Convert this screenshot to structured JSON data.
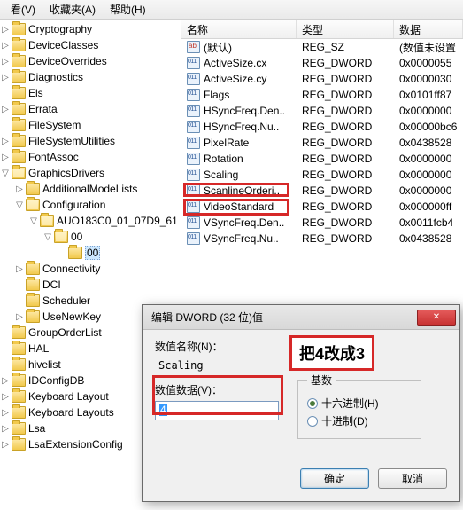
{
  "menu": {
    "view": "看(V)",
    "favorites": "收藏夹(A)",
    "help": "帮助(H)"
  },
  "tree": [
    {
      "label": "Cryptography",
      "depth": 0,
      "toggle": "▷"
    },
    {
      "label": "DeviceClasses",
      "depth": 0,
      "toggle": "▷"
    },
    {
      "label": "DeviceOverrides",
      "depth": 0,
      "toggle": "▷"
    },
    {
      "label": "Diagnostics",
      "depth": 0,
      "toggle": "▷"
    },
    {
      "label": "Els",
      "depth": 0,
      "toggle": ""
    },
    {
      "label": "Errata",
      "depth": 0,
      "toggle": "▷"
    },
    {
      "label": "FileSystem",
      "depth": 0,
      "toggle": ""
    },
    {
      "label": "FileSystemUtilities",
      "depth": 0,
      "toggle": "▷"
    },
    {
      "label": "FontAssoc",
      "depth": 0,
      "toggle": "▷"
    },
    {
      "label": "GraphicsDrivers",
      "depth": 0,
      "toggle": "▽",
      "open": true
    },
    {
      "label": "AdditionalModeLists",
      "depth": 1,
      "toggle": "▷"
    },
    {
      "label": "Configuration",
      "depth": 1,
      "toggle": "▽",
      "open": true
    },
    {
      "label": "AUO183C0_01_07D9_61",
      "depth": 2,
      "toggle": "▽",
      "open": true
    },
    {
      "label": "00",
      "depth": 3,
      "toggle": "▽",
      "open": true
    },
    {
      "label": "00",
      "depth": 4,
      "toggle": "",
      "selected": true
    },
    {
      "label": "Connectivity",
      "depth": 1,
      "toggle": "▷"
    },
    {
      "label": "DCI",
      "depth": 1,
      "toggle": ""
    },
    {
      "label": "Scheduler",
      "depth": 1,
      "toggle": ""
    },
    {
      "label": "UseNewKey",
      "depth": 1,
      "toggle": "▷"
    },
    {
      "label": "GroupOrderList",
      "depth": 0,
      "toggle": ""
    },
    {
      "label": "HAL",
      "depth": 0,
      "toggle": ""
    },
    {
      "label": "hivelist",
      "depth": 0,
      "toggle": ""
    },
    {
      "label": "IDConfigDB",
      "depth": 0,
      "toggle": "▷"
    },
    {
      "label": "Keyboard Layout",
      "depth": 0,
      "toggle": "▷"
    },
    {
      "label": "Keyboard Layouts",
      "depth": 0,
      "toggle": "▷"
    },
    {
      "label": "Lsa",
      "depth": 0,
      "toggle": "▷"
    },
    {
      "label": "LsaExtensionConfig",
      "depth": 0,
      "toggle": "▷"
    }
  ],
  "columns": {
    "name": "名称",
    "type": "类型",
    "data": "数据"
  },
  "rows": [
    {
      "icon": "sz",
      "name": "(默认)",
      "type": "REG_SZ",
      "data": "(数值未设置"
    },
    {
      "icon": "bin",
      "name": "ActiveSize.cx",
      "type": "REG_DWORD",
      "data": "0x0000055"
    },
    {
      "icon": "bin",
      "name": "ActiveSize.cy",
      "type": "REG_DWORD",
      "data": "0x0000030"
    },
    {
      "icon": "bin",
      "name": "Flags",
      "type": "REG_DWORD",
      "data": "0x0101ff87"
    },
    {
      "icon": "bin",
      "name": "HSyncFreq.Den..",
      "type": "REG_DWORD",
      "data": "0x0000000"
    },
    {
      "icon": "bin",
      "name": "HSyncFreq.Nu..",
      "type": "REG_DWORD",
      "data": "0x00000bc6"
    },
    {
      "icon": "bin",
      "name": "PixelRate",
      "type": "REG_DWORD",
      "data": "0x0438528"
    },
    {
      "icon": "bin",
      "name": "Rotation",
      "type": "REG_DWORD",
      "data": "0x0000000"
    },
    {
      "icon": "bin",
      "name": "Scaling",
      "type": "REG_DWORD",
      "data": "0x0000000"
    },
    {
      "icon": "bin",
      "name": "ScanlineOrderi..",
      "type": "REG_DWORD",
      "data": "0x0000000"
    },
    {
      "icon": "bin",
      "name": "VideoStandard",
      "type": "REG_DWORD",
      "data": "0x000000ff"
    },
    {
      "icon": "bin",
      "name": "VSyncFreq.Den..",
      "type": "REG_DWORD",
      "data": "0x0011fcb4"
    },
    {
      "icon": "bin",
      "name": "VSyncFreq.Nu..",
      "type": "REG_DWORD",
      "data": "0x0438528"
    }
  ],
  "dialog": {
    "title": "编辑 DWORD (32 位)值",
    "name_label": "数值名称(N)：",
    "value_name": "Scaling",
    "data_label": "数值数据(V)：",
    "data_value": "4",
    "base_label": "基数",
    "hex_label": "十六进制(H)",
    "dec_label": "十进制(D)",
    "ok": "确定",
    "cancel": "取消"
  },
  "callout": "把4改成3"
}
